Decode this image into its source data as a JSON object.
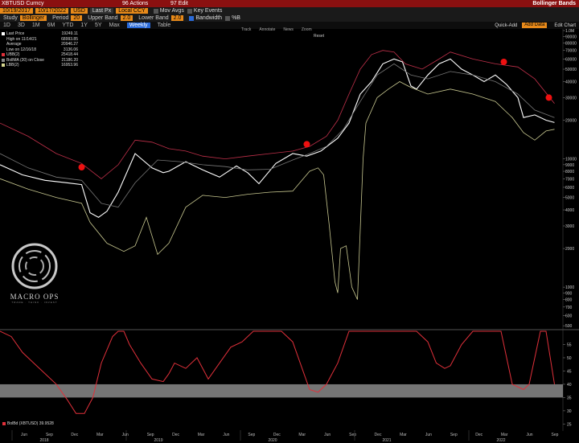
{
  "toolbar": {
    "ticker": "XBTUSD Curncy",
    "actions": "96 Actions",
    "edit": "97 Edit",
    "title": "Bollinger Bands",
    "date_from": "10/19/2017",
    "date_to": "10/17/2022",
    "period_unit": "USD",
    "last_px_label": "Last Px",
    "local_ccy": "Local CCY",
    "mov_avgs": "Mov Avgs",
    "key_events": "Key Events",
    "study_label": "Study",
    "study": "Bollinger",
    "period_label": "Period",
    "period": "20",
    "upper_band_label": "Upper Band",
    "upper_band": "2.0",
    "lower_band_label": "Lower Band",
    "lower_band": "2.0",
    "bandwidth_label": "Bandwidth",
    "bandwidth_code": "%B",
    "timeframes": [
      "1D",
      "3D",
      "1M",
      "6M",
      "YTD",
      "1Y",
      "5Y",
      "Max"
    ],
    "freq": "Weekly",
    "chart_mode": "Table",
    "track": "Track",
    "annotate": "Annotate",
    "news": "News",
    "zoom": "Zoom",
    "reset": "Reset",
    "quick_add": "Quick-Add",
    "add_data": "Add Data",
    "edit_chart": "Edit Chart"
  },
  "legend": [
    {
      "label": "Last Price",
      "value": "19249.11",
      "color": "#ffffff"
    },
    {
      "label": "High on 11/14/21",
      "value": "68993.85",
      "color": ""
    },
    {
      "label": "Average",
      "value": "20946.27",
      "color": ""
    },
    {
      "label": "Low on 12/16/18",
      "value": "3136.06",
      "color": ""
    },
    {
      "label": "UBB(2)",
      "value": "25418.44",
      "color": "#e0303a"
    },
    {
      "label": "BollMA (20)  on Close",
      "value": "21186.20",
      "color": "#888888"
    },
    {
      "label": "LBB(2)",
      "value": "16953.96",
      "color": "#d8d890"
    }
  ],
  "logo": {
    "name": "MACRO OPS",
    "sub": "TRADE · THINK · INVEST"
  },
  "bandwidth_legend": {
    "label": "BolBd (XBTUSD)",
    "value": "39.9528"
  },
  "chart_data": {
    "type": "line",
    "scale": "log",
    "price_axis_labels": [
      "1.0M",
      "90000",
      "80000",
      "70000",
      "60000",
      "50000",
      "40000",
      "30000",
      "20000",
      "10000",
      "9000",
      "8000",
      "7000",
      "6000",
      "5000",
      "4000",
      "3000",
      "2000",
      "1000",
      "900",
      "800",
      "700",
      "600",
      "500"
    ],
    "price_axis_values": [
      100000,
      90000,
      80000,
      70000,
      60000,
      50000,
      40000,
      30000,
      20000,
      10000,
      9000,
      8000,
      7000,
      6000,
      5000,
      4000,
      3000,
      2000,
      1000,
      900,
      800,
      700,
      600,
      500
    ],
    "lower_axis_ticks": [
      55,
      50,
      45,
      40,
      35,
      30,
      25
    ],
    "lower_ylim": [
      23,
      60
    ],
    "highlight_band": [
      35,
      40
    ],
    "time_labels": [
      "Jun",
      "Sep",
      "Dec",
      "Mar",
      "Jun",
      "Sep",
      "Dec",
      "Mar",
      "Jun",
      "Sep",
      "Dec",
      "Mar",
      "Jun",
      "Sep",
      "Dec",
      "Mar",
      "Jun",
      "Sep",
      "Dec",
      "Mar",
      "Jun",
      "Sep"
    ],
    "year_labels": [
      "2018",
      "2019",
      "2020",
      "2021",
      "2022"
    ],
    "markers": [
      {
        "t": 0.145,
        "price": 8600
      },
      {
        "t": 0.545,
        "price": 13000
      },
      {
        "t": 0.895,
        "price": 57000
      },
      {
        "t": 0.975,
        "price": 30000
      }
    ],
    "series": [
      {
        "name": "Last Price",
        "color": "#ffffff",
        "t": [
          0.0,
          0.04,
          0.08,
          0.12,
          0.145,
          0.16,
          0.175,
          0.19,
          0.21,
          0.24,
          0.27,
          0.29,
          0.3,
          0.33,
          0.36,
          0.39,
          0.42,
          0.44,
          0.46,
          0.49,
          0.52,
          0.545,
          0.57,
          0.6,
          0.62,
          0.64,
          0.66,
          0.68,
          0.7,
          0.715,
          0.73,
          0.74,
          0.76,
          0.78,
          0.8,
          0.82,
          0.84,
          0.86,
          0.88,
          0.9,
          0.92,
          0.93,
          0.95,
          0.97,
          0.985
        ],
        "price": [
          9000,
          7500,
          6800,
          6500,
          6300,
          3800,
          3500,
          3900,
          5500,
          11000,
          8500,
          7800,
          8000,
          9500,
          8200,
          7200,
          8800,
          7800,
          6400,
          9200,
          11000,
          10500,
          11500,
          14500,
          19000,
          32000,
          40000,
          55000,
          60000,
          57000,
          37000,
          35000,
          45000,
          55000,
          60000,
          50000,
          45000,
          40000,
          45000,
          38000,
          30000,
          21000,
          22000,
          20000,
          19200
        ]
      },
      {
        "name": "UBB(2)",
        "color": "#c0304a",
        "t": [
          0.0,
          0.05,
          0.1,
          0.145,
          0.18,
          0.21,
          0.24,
          0.27,
          0.3,
          0.33,
          0.36,
          0.4,
          0.44,
          0.48,
          0.52,
          0.55,
          0.58,
          0.6,
          0.62,
          0.64,
          0.66,
          0.68,
          0.7,
          0.72,
          0.75,
          0.78,
          0.8,
          0.84,
          0.88,
          0.92,
          0.95,
          0.985
        ],
        "price": [
          19000,
          15000,
          11000,
          9200,
          7000,
          9000,
          14000,
          13500,
          12000,
          11500,
          10500,
          10000,
          10500,
          11000,
          11500,
          12500,
          15000,
          20000,
          32000,
          50000,
          65000,
          70000,
          68000,
          55000,
          50000,
          60000,
          68000,
          60000,
          55000,
          52000,
          42000,
          27000
        ]
      },
      {
        "name": "BollMA (20) on Close",
        "color": "#777777",
        "t": [
          0.0,
          0.05,
          0.1,
          0.145,
          0.18,
          0.21,
          0.24,
          0.28,
          0.32,
          0.36,
          0.4,
          0.44,
          0.48,
          0.52,
          0.55,
          0.58,
          0.61,
          0.64,
          0.67,
          0.7,
          0.73,
          0.76,
          0.8,
          0.84,
          0.88,
          0.92,
          0.95,
          0.985
        ],
        "price": [
          11000,
          8500,
          7200,
          6800,
          4500,
          4200,
          6500,
          9800,
          9500,
          9000,
          8700,
          8200,
          8300,
          9800,
          11000,
          12500,
          17000,
          28000,
          45000,
          55000,
          45000,
          42000,
          48000,
          45000,
          40000,
          32000,
          24000,
          21000
        ]
      },
      {
        "name": "LBB(2)",
        "color": "#c8c890",
        "t": [
          0.0,
          0.05,
          0.1,
          0.145,
          0.16,
          0.19,
          0.22,
          0.24,
          0.26,
          0.28,
          0.3,
          0.33,
          0.36,
          0.4,
          0.44,
          0.48,
          0.52,
          0.55,
          0.565,
          0.575,
          0.585,
          0.595,
          0.6,
          0.605,
          0.615,
          0.625,
          0.635,
          0.645,
          0.65,
          0.67,
          0.69,
          0.71,
          0.73,
          0.76,
          0.8,
          0.84,
          0.88,
          0.91,
          0.93,
          0.95,
          0.97,
          0.985
        ],
        "price": [
          7000,
          5800,
          5000,
          4500,
          3200,
          2200,
          1900,
          2100,
          3500,
          1800,
          2200,
          4200,
          5200,
          5000,
          5300,
          5500,
          5600,
          8000,
          8500,
          7500,
          3000,
          1100,
          900,
          2000,
          2100,
          1000,
          800,
          10000,
          19000,
          30000,
          35000,
          40000,
          36000,
          32000,
          35000,
          32000,
          28000,
          21000,
          16000,
          14000,
          16500,
          17000
        ]
      }
    ],
    "bandwidth": {
      "name": "BolBd (XBTUSD)",
      "color": "#e0303a",
      "t": [
        0.0,
        0.02,
        0.04,
        0.06,
        0.08,
        0.1,
        0.12,
        0.135,
        0.15,
        0.165,
        0.18,
        0.2,
        0.21,
        0.22,
        0.23,
        0.25,
        0.27,
        0.29,
        0.3,
        0.31,
        0.33,
        0.35,
        0.37,
        0.39,
        0.41,
        0.43,
        0.45,
        0.48,
        0.5,
        0.52,
        0.54,
        0.55,
        0.565,
        0.58,
        0.6,
        0.62,
        0.64,
        0.66,
        0.7,
        0.74,
        0.76,
        0.775,
        0.79,
        0.8,
        0.82,
        0.84,
        0.86,
        0.88,
        0.89,
        0.9,
        0.91,
        0.93,
        0.94,
        0.95,
        0.96,
        0.97,
        0.985
      ],
      "value": [
        65,
        58,
        52,
        48,
        44,
        40,
        34,
        29,
        29,
        35,
        48,
        58,
        65,
        60,
        55,
        48,
        42,
        41,
        44,
        48,
        46,
        50,
        42,
        48,
        54,
        56,
        60,
        70,
        70,
        56,
        44,
        38,
        37,
        40,
        48,
        60,
        68,
        70,
        70,
        70,
        56,
        48,
        46,
        47,
        55,
        65,
        70,
        70,
        60,
        50,
        40,
        38,
        40,
        50,
        62,
        70,
        40
      ]
    }
  }
}
